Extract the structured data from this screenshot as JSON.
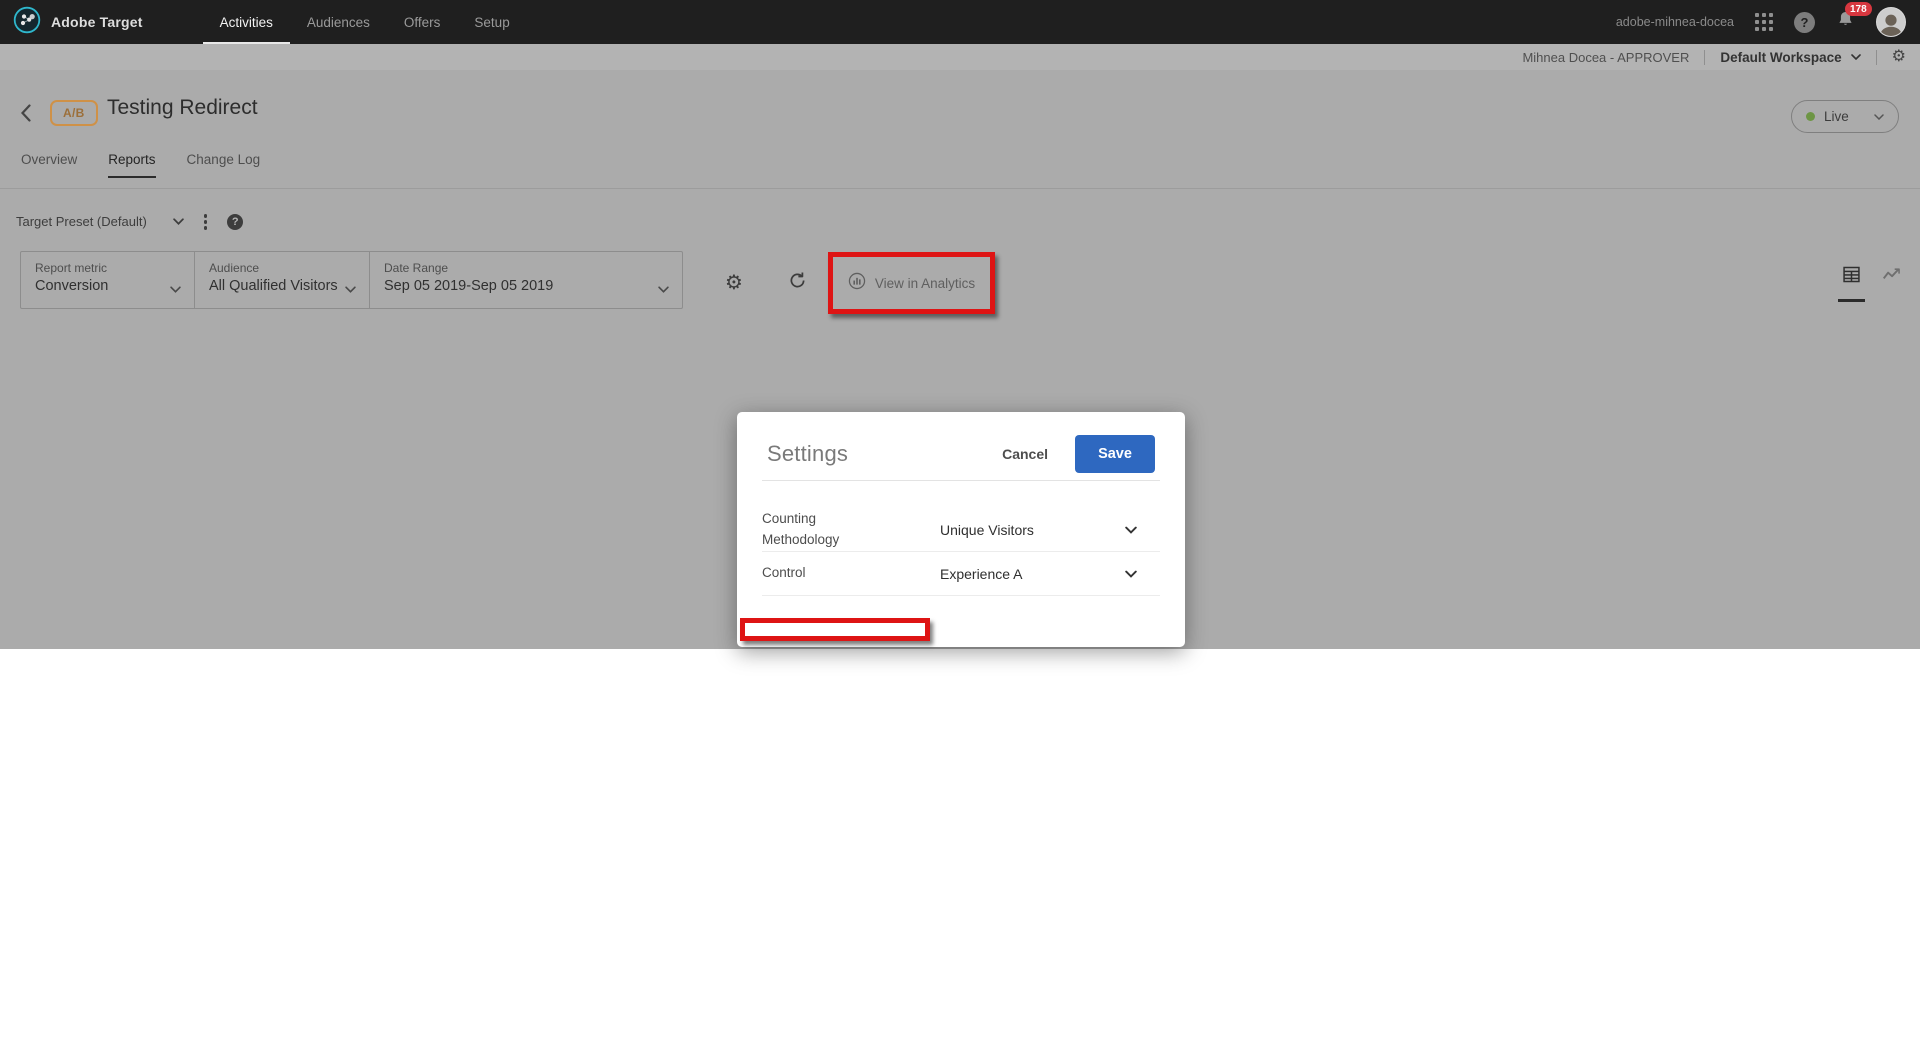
{
  "nav": {
    "brand": "Adobe Target",
    "items": [
      {
        "label": "Activities"
      },
      {
        "label": "Audiences"
      },
      {
        "label": "Offers"
      },
      {
        "label": "Setup"
      }
    ],
    "account": "adobe-mihnea-docea",
    "notification_count": "178"
  },
  "workspace_bar": {
    "user_role": "Mihnea Docea - APPROVER",
    "workspace": "Default Workspace"
  },
  "page": {
    "activity_type_badge": "A/B",
    "title": "Testing Redirect",
    "status": "Live",
    "tabs": [
      {
        "label": "Overview"
      },
      {
        "label": "Reports"
      },
      {
        "label": "Change Log"
      }
    ]
  },
  "report_toolbar": {
    "preset": "Target Preset (Default)",
    "controls": [
      {
        "label": "Report metric",
        "value": "Conversion"
      },
      {
        "label": "Audience",
        "value": "All Qualified Visitors"
      },
      {
        "label": "Date Range",
        "value": "Sep 05 2019-Sep 05 2019"
      }
    ],
    "view_in_analytics": "View in Analytics"
  },
  "modal": {
    "title": "Settings",
    "cancel": "Cancel",
    "save": "Save",
    "fields": [
      {
        "label": "Counting Methodology",
        "value": "Unique Visitors"
      },
      {
        "label": "Control",
        "value": "Experience A"
      }
    ]
  },
  "icons": {
    "gear": "⚙",
    "help": "?"
  },
  "colors": {
    "accent-red": "#de1414",
    "save-blue": "#2e68c0",
    "live-green": "#6d9544",
    "badge-orange": "#cf9147",
    "notif-red": "#d7373f",
    "nav-dark": "#1f1f1f",
    "dim-bg": "#ababab",
    "subbar-bg": "#b3b3b3"
  }
}
